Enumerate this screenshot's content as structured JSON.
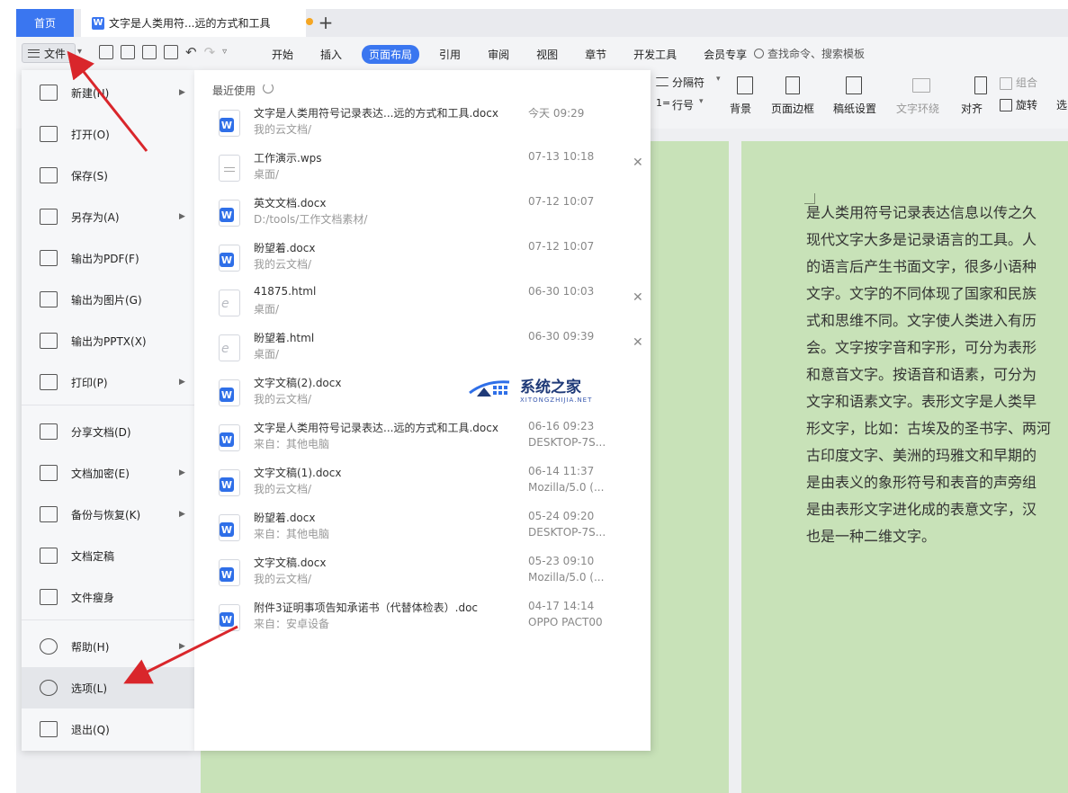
{
  "tabs": {
    "home": "首页",
    "doc_title": "文字是人类用符...远的方式和工具",
    "add": "+"
  },
  "menubar": {
    "file": "文件",
    "items": [
      "开始",
      "插入",
      "页面布局",
      "引用",
      "审阅",
      "视图",
      "章节",
      "开发工具",
      "会员专享"
    ],
    "active_index": 2,
    "search": "查找命令、搜索模板"
  },
  "ribbon": {
    "separator": "分隔符",
    "line_no": "行号",
    "background": "背景",
    "page_border": "页面边框",
    "manuscript": "稿纸设置",
    "text_wrap": "文字环绕",
    "align": "对齐",
    "group": "组合",
    "rotate": "旋转",
    "select": "选"
  },
  "file_menu": {
    "items": [
      {
        "label": "新建(N)",
        "icon": "new-doc-icon",
        "submenu": true
      },
      {
        "label": "打开(O)",
        "icon": "folder-icon",
        "submenu": false
      },
      {
        "label": "保存(S)",
        "icon": "save-icon",
        "submenu": false
      },
      {
        "label": "另存为(A)",
        "icon": "save-as-icon",
        "submenu": true
      },
      {
        "label": "输出为PDF(F)",
        "icon": "pdf-icon",
        "submenu": false
      },
      {
        "label": "输出为图片(G)",
        "icon": "image-icon",
        "submenu": false
      },
      {
        "label": "输出为PPTX(X)",
        "icon": "pptx-icon",
        "submenu": false
      },
      {
        "label": "打印(P)",
        "icon": "printer-icon",
        "submenu": true
      },
      {
        "label": "分享文档(D)",
        "icon": "share-icon",
        "submenu": false
      },
      {
        "label": "文档加密(E)",
        "icon": "encrypt-icon",
        "submenu": true
      },
      {
        "label": "备份与恢复(K)",
        "icon": "backup-icon",
        "submenu": true
      },
      {
        "label": "文档定稿",
        "icon": "finalize-icon",
        "submenu": false
      },
      {
        "label": "文件瘦身",
        "icon": "slim-icon",
        "submenu": false
      },
      {
        "label": "帮助(H)",
        "icon": "help-icon",
        "submenu": true
      },
      {
        "label": "选项(L)",
        "icon": "gear-icon",
        "submenu": false
      },
      {
        "label": "退出(Q)",
        "icon": "exit-icon",
        "submenu": false
      }
    ]
  },
  "recent": {
    "title": "最近使用",
    "files": [
      {
        "name": "文字是人类用符号记录表达...远的方式和工具.docx",
        "path": "我的云文档/",
        "time": "今天  09:29",
        "source": "",
        "type": "w",
        "closable": false
      },
      {
        "name": "工作演示.wps",
        "path": "桌面/",
        "time": "07-13 10:18",
        "source": "",
        "type": "blank",
        "closable": true
      },
      {
        "name": "英文文档.docx",
        "path": "D:/tools/工作文档素材/",
        "time": "07-12 10:07",
        "source": "",
        "type": "w",
        "closable": false
      },
      {
        "name": "盼望着.docx",
        "path": "我的云文档/",
        "time": "07-12 10:07",
        "source": "",
        "type": "w",
        "closable": false
      },
      {
        "name": "41875.html",
        "path": "桌面/",
        "time": "06-30 10:03",
        "source": "",
        "type": "html",
        "closable": true
      },
      {
        "name": "盼望着.html",
        "path": "桌面/",
        "time": "06-30 09:39",
        "source": "",
        "type": "html",
        "closable": true
      },
      {
        "name": "文字文稿(2).docx",
        "path": "我的云文档/",
        "time": "",
        "source": "",
        "type": "w",
        "closable": false
      },
      {
        "name": "文字是人类用符号记录表达...远的方式和工具.docx",
        "path": "来自：其他电脑",
        "time": "06-16 09:23",
        "source": "DESKTOP-7S...",
        "type": "w",
        "closable": false
      },
      {
        "name": "文字文稿(1).docx",
        "path": "我的云文档/",
        "time": "06-14 11:37",
        "source": "Mozilla/5.0 (...",
        "type": "w",
        "closable": false
      },
      {
        "name": "盼望着.docx",
        "path": "来自：其他电脑",
        "time": "05-24 09:20",
        "source": "DESKTOP-7S...",
        "type": "w",
        "closable": false
      },
      {
        "name": "文字文稿.docx",
        "path": "我的云文档/",
        "time": "05-23 09:10",
        "source": "Mozilla/5.0 (...",
        "type": "w",
        "closable": false
      },
      {
        "name": "附件3证明事项告知承诺书（代替体检表）.doc",
        "path": "来自：安卓设备",
        "time": "04-17 14:14",
        "source": "OPPO PACT00",
        "type": "w",
        "closable": false
      }
    ]
  },
  "document": {
    "lines": [
      "是人类用符号记录表达信息以传之久",
      "现代文字大多是记录语言的工具。人",
      "的语言后产生书面文字，很多小语种",
      "文字。文字的不同体现了国家和民族",
      "式和思维不同。文字使人类进入有历",
      "会。文字按字音和字形，可分为表形",
      "和意音文字。按语音和语素，可分为",
      "文字和语素文字。表形文字是人类早",
      "形文字，比如：古埃及的圣书字、两河",
      "古印度文字、美洲的玛雅文和早期的",
      "是由表义的象形符号和表音的声旁组",
      "是由表形文字进化成的表意文字，汉",
      "也是一种二维文字。"
    ]
  },
  "watermark": {
    "cn": "系统之家",
    "en": "XITONGZHIJIA.NET"
  },
  "colors": {
    "accent": "#3a76f0",
    "doc_bg": "#c8e2b8",
    "arrow": "#d9262b"
  }
}
